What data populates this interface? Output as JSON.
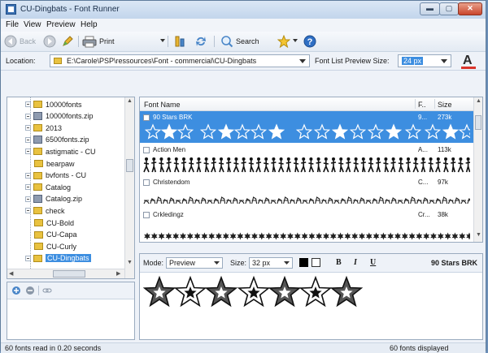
{
  "window": {
    "title": "CU-Dingbats - Font Runner"
  },
  "menu": [
    "File",
    "View",
    "Preview",
    "Help"
  ],
  "toolbar": {
    "back": "Back",
    "print": "Print",
    "search": "Search"
  },
  "location": {
    "label": "Location:",
    "path": "E:\\Carole\\PSP\\ressources\\Font - commercial\\CU-Dingbats",
    "preview_size_label": "Font List Preview Size:",
    "preview_size_value": "24 px"
  },
  "tree": [
    {
      "label": "10000fonts",
      "type": "folder",
      "expand": true
    },
    {
      "label": "10000fonts.zip",
      "type": "zip",
      "expand": true
    },
    {
      "label": "2013",
      "type": "folder",
      "expand": true
    },
    {
      "label": "6500fonts.zip",
      "type": "zip",
      "expand": true
    },
    {
      "label": "astigmatic - CU",
      "type": "folder",
      "expand": true
    },
    {
      "label": "bearpaw",
      "type": "folder",
      "expand": false
    },
    {
      "label": "bvfonts - CU",
      "type": "folder",
      "expand": true
    },
    {
      "label": "Catalog",
      "type": "folder",
      "expand": true
    },
    {
      "label": "Catalog.zip",
      "type": "zip",
      "expand": true
    },
    {
      "label": "check",
      "type": "folder",
      "expand": true
    },
    {
      "label": "CU-Bold",
      "type": "folder",
      "expand": false
    },
    {
      "label": "CU-Capa",
      "type": "folder",
      "expand": false
    },
    {
      "label": "CU-Curly",
      "type": "folder",
      "expand": false
    },
    {
      "label": "CU-Dingbats",
      "type": "folder",
      "expand": true,
      "selected": true
    }
  ],
  "fontlist": {
    "col_name": "Font Name",
    "col_f": "F..",
    "col_size": "Size",
    "rows": [
      {
        "name": "90 Stars BRK",
        "f": "9...",
        "size": "273k",
        "selected": true
      },
      {
        "name": "Action Men",
        "f": "A...",
        "size": "113k"
      },
      {
        "name": "Christendom",
        "f": "C...",
        "size": "97k"
      },
      {
        "name": "Crkledingz",
        "f": "Cr...",
        "size": "38k"
      }
    ]
  },
  "preview": {
    "mode_label": "Mode:",
    "mode_value": "Preview",
    "size_label": "Size:",
    "size_value": "32 px",
    "bold": "B",
    "italic": "I",
    "underline": "U",
    "font_name": "90 Stars BRK"
  },
  "status": {
    "left": "60 fonts read in 0.20 seconds",
    "right": "60 fonts displayed"
  }
}
